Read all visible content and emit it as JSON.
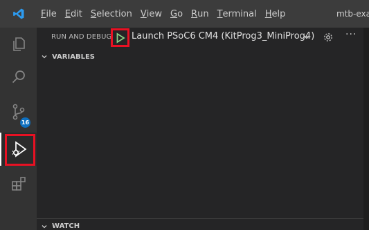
{
  "menubar": {
    "items": [
      {
        "mnemonic": "F",
        "rest": "ile"
      },
      {
        "mnemonic": "E",
        "rest": "dit"
      },
      {
        "mnemonic": "S",
        "rest": "election"
      },
      {
        "mnemonic": "V",
        "rest": "iew"
      },
      {
        "mnemonic": "G",
        "rest": "o"
      },
      {
        "mnemonic": "R",
        "rest": "un"
      },
      {
        "mnemonic": "T",
        "rest": "erminal"
      },
      {
        "mnemonic": "H",
        "rest": "elp"
      }
    ],
    "window_title": "mtb-exa"
  },
  "activitybar": {
    "icons": [
      "explorer-icon",
      "search-icon",
      "source-control-icon",
      "run-debug-icon",
      "extensions-icon"
    ],
    "source_control_badge": "16"
  },
  "debug": {
    "title": "RUN AND DEBUG",
    "launch_config": "Launch PSoC6 CM4 (KitProg3_MiniProg4)"
  },
  "sections": {
    "variables": "VARIABLES",
    "watch": "WATCH"
  },
  "colors": {
    "accent_blue": "#0e70c0",
    "highlight_red": "#e81123",
    "play_green": "#89d185"
  }
}
